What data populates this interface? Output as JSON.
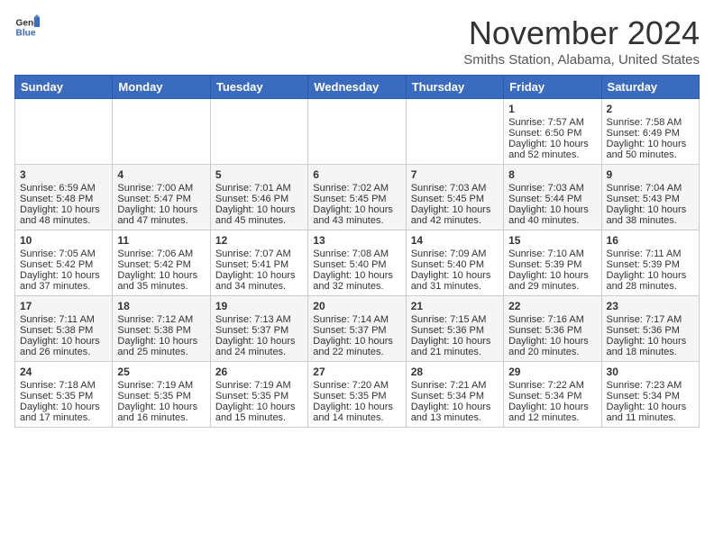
{
  "header": {
    "logo_general": "General",
    "logo_blue": "Blue",
    "month_title": "November 2024",
    "location": "Smiths Station, Alabama, United States"
  },
  "days_of_week": [
    "Sunday",
    "Monday",
    "Tuesday",
    "Wednesday",
    "Thursday",
    "Friday",
    "Saturday"
  ],
  "weeks": [
    {
      "days": [
        {
          "num": "",
          "info": ""
        },
        {
          "num": "",
          "info": ""
        },
        {
          "num": "",
          "info": ""
        },
        {
          "num": "",
          "info": ""
        },
        {
          "num": "",
          "info": ""
        },
        {
          "num": "1",
          "info": "Sunrise: 7:57 AM\nSunset: 6:50 PM\nDaylight: 10 hours\nand 52 minutes."
        },
        {
          "num": "2",
          "info": "Sunrise: 7:58 AM\nSunset: 6:49 PM\nDaylight: 10 hours\nand 50 minutes."
        }
      ]
    },
    {
      "days": [
        {
          "num": "3",
          "info": "Sunrise: 6:59 AM\nSunset: 5:48 PM\nDaylight: 10 hours\nand 48 minutes."
        },
        {
          "num": "4",
          "info": "Sunrise: 7:00 AM\nSunset: 5:47 PM\nDaylight: 10 hours\nand 47 minutes."
        },
        {
          "num": "5",
          "info": "Sunrise: 7:01 AM\nSunset: 5:46 PM\nDaylight: 10 hours\nand 45 minutes."
        },
        {
          "num": "6",
          "info": "Sunrise: 7:02 AM\nSunset: 5:45 PM\nDaylight: 10 hours\nand 43 minutes."
        },
        {
          "num": "7",
          "info": "Sunrise: 7:03 AM\nSunset: 5:45 PM\nDaylight: 10 hours\nand 42 minutes."
        },
        {
          "num": "8",
          "info": "Sunrise: 7:03 AM\nSunset: 5:44 PM\nDaylight: 10 hours\nand 40 minutes."
        },
        {
          "num": "9",
          "info": "Sunrise: 7:04 AM\nSunset: 5:43 PM\nDaylight: 10 hours\nand 38 minutes."
        }
      ]
    },
    {
      "days": [
        {
          "num": "10",
          "info": "Sunrise: 7:05 AM\nSunset: 5:42 PM\nDaylight: 10 hours\nand 37 minutes."
        },
        {
          "num": "11",
          "info": "Sunrise: 7:06 AM\nSunset: 5:42 PM\nDaylight: 10 hours\nand 35 minutes."
        },
        {
          "num": "12",
          "info": "Sunrise: 7:07 AM\nSunset: 5:41 PM\nDaylight: 10 hours\nand 34 minutes."
        },
        {
          "num": "13",
          "info": "Sunrise: 7:08 AM\nSunset: 5:40 PM\nDaylight: 10 hours\nand 32 minutes."
        },
        {
          "num": "14",
          "info": "Sunrise: 7:09 AM\nSunset: 5:40 PM\nDaylight: 10 hours\nand 31 minutes."
        },
        {
          "num": "15",
          "info": "Sunrise: 7:10 AM\nSunset: 5:39 PM\nDaylight: 10 hours\nand 29 minutes."
        },
        {
          "num": "16",
          "info": "Sunrise: 7:11 AM\nSunset: 5:39 PM\nDaylight: 10 hours\nand 28 minutes."
        }
      ]
    },
    {
      "days": [
        {
          "num": "17",
          "info": "Sunrise: 7:11 AM\nSunset: 5:38 PM\nDaylight: 10 hours\nand 26 minutes."
        },
        {
          "num": "18",
          "info": "Sunrise: 7:12 AM\nSunset: 5:38 PM\nDaylight: 10 hours\nand 25 minutes."
        },
        {
          "num": "19",
          "info": "Sunrise: 7:13 AM\nSunset: 5:37 PM\nDaylight: 10 hours\nand 24 minutes."
        },
        {
          "num": "20",
          "info": "Sunrise: 7:14 AM\nSunset: 5:37 PM\nDaylight: 10 hours\nand 22 minutes."
        },
        {
          "num": "21",
          "info": "Sunrise: 7:15 AM\nSunset: 5:36 PM\nDaylight: 10 hours\nand 21 minutes."
        },
        {
          "num": "22",
          "info": "Sunrise: 7:16 AM\nSunset: 5:36 PM\nDaylight: 10 hours\nand 20 minutes."
        },
        {
          "num": "23",
          "info": "Sunrise: 7:17 AM\nSunset: 5:36 PM\nDaylight: 10 hours\nand 18 minutes."
        }
      ]
    },
    {
      "days": [
        {
          "num": "24",
          "info": "Sunrise: 7:18 AM\nSunset: 5:35 PM\nDaylight: 10 hours\nand 17 minutes."
        },
        {
          "num": "25",
          "info": "Sunrise: 7:19 AM\nSunset: 5:35 PM\nDaylight: 10 hours\nand 16 minutes."
        },
        {
          "num": "26",
          "info": "Sunrise: 7:19 AM\nSunset: 5:35 PM\nDaylight: 10 hours\nand 15 minutes."
        },
        {
          "num": "27",
          "info": "Sunrise: 7:20 AM\nSunset: 5:35 PM\nDaylight: 10 hours\nand 14 minutes."
        },
        {
          "num": "28",
          "info": "Sunrise: 7:21 AM\nSunset: 5:34 PM\nDaylight: 10 hours\nand 13 minutes."
        },
        {
          "num": "29",
          "info": "Sunrise: 7:22 AM\nSunset: 5:34 PM\nDaylight: 10 hours\nand 12 minutes."
        },
        {
          "num": "30",
          "info": "Sunrise: 7:23 AM\nSunset: 5:34 PM\nDaylight: 10 hours\nand 11 minutes."
        }
      ]
    }
  ]
}
